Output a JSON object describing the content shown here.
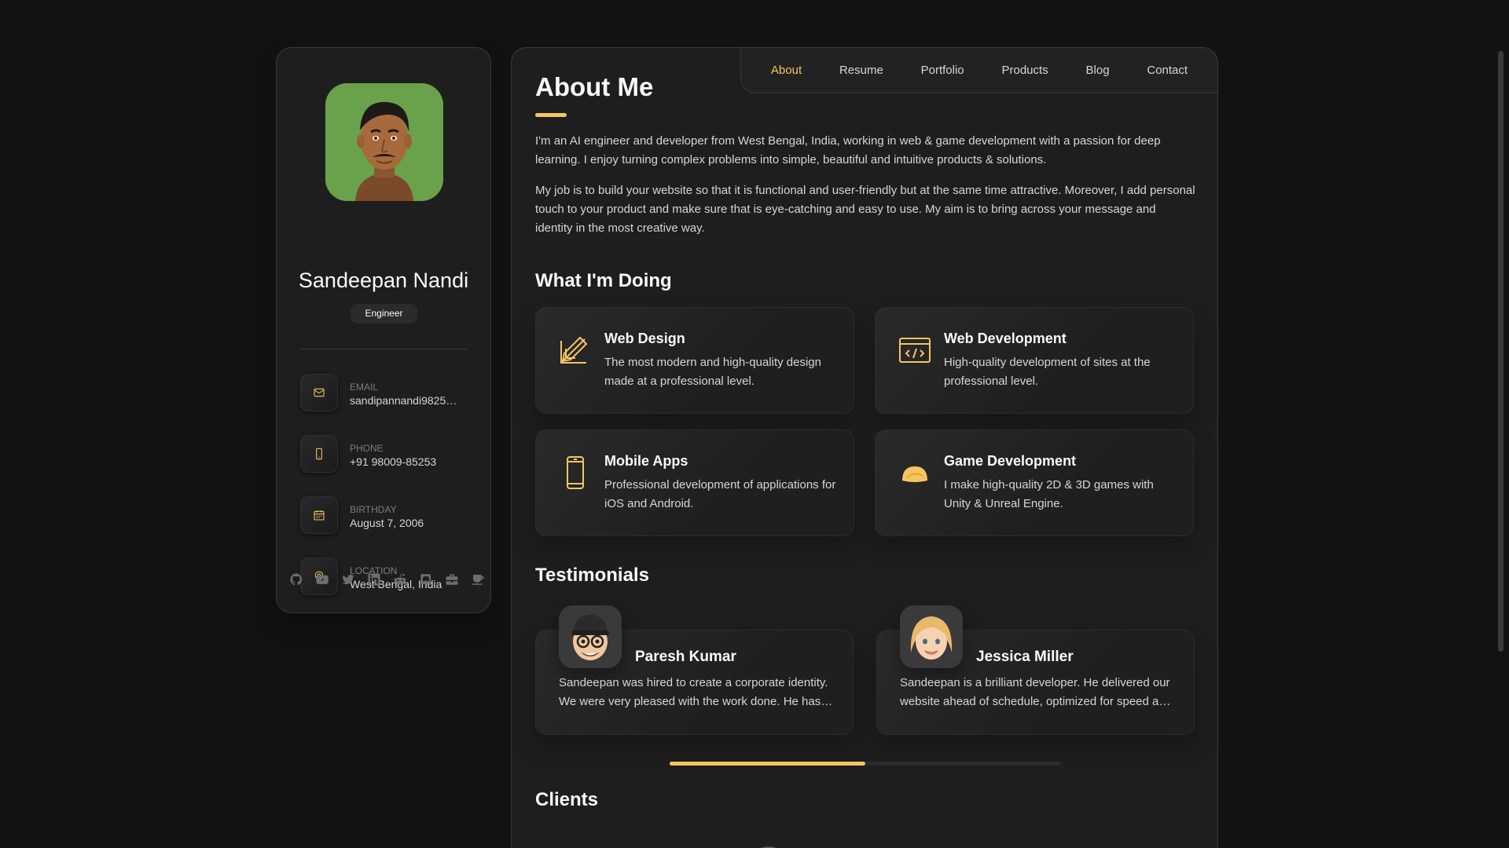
{
  "profile": {
    "name": "Sandeepan Nandi",
    "title": "Engineer",
    "avatar_bg": "#6aa24b"
  },
  "contacts": [
    {
      "icon": "mail-icon",
      "label": "Email",
      "value": "sandipannandi9825…"
    },
    {
      "icon": "phone-icon",
      "label": "Phone",
      "value": "+91 98009-85253"
    },
    {
      "icon": "calendar-icon",
      "label": "Birthday",
      "value": "August 7, 2006"
    },
    {
      "icon": "location-pin-icon",
      "label": "Location",
      "value": "West Bengal, India"
    }
  ],
  "socials": [
    "github-icon",
    "youtube-icon",
    "twitter-icon",
    "linkedin-icon",
    "reddit-icon",
    "discord-icon",
    "briefcase-icon",
    "coffee-icon"
  ],
  "nav": {
    "items": [
      "About",
      "Resume",
      "Portfolio",
      "Products",
      "Blog",
      "Contact"
    ],
    "active": "About"
  },
  "about": {
    "heading": "About Me",
    "paragraph1": "I'm an AI engineer and developer from West Bengal, India, working in web & game development with a passion for deep learning. I enjoy turning complex problems into simple, beautiful and intuitive products & solutions.",
    "paragraph2": "My job is to build your website so that it is functional and user-friendly but at the same time attractive. Moreover, I add personal touch to your product and make sure that is eye-catching and easy to use. My aim is to bring across your message and identity in the most creative way."
  },
  "services": {
    "heading": "What I'm Doing",
    "items": [
      {
        "icon": "design-pencil-ruler-icon",
        "title": "Web Design",
        "desc": "The most modern and high-quality design made at a professional level."
      },
      {
        "icon": "code-window-icon",
        "title": "Web Development",
        "desc": "High-quality development of sites at the professional level."
      },
      {
        "icon": "smartphone-icon",
        "title": "Mobile Apps",
        "desc": "Professional development of applications for iOS and Android."
      },
      {
        "icon": "game-blob-icon",
        "title": "Game Development",
        "desc": "I make high-quality 2D & 3D games with Unity & Unreal Engine."
      }
    ]
  },
  "testimonials": {
    "heading": "Testimonials",
    "items": [
      {
        "name": "Paresh Kumar",
        "text": "Sandeepan was hired to create a corporate identity. We were very pleased with the work done. He has a lot of experience and is very concerned about the needs of client."
      },
      {
        "name": "Jessica Miller",
        "text": "Sandeepan is a brilliant developer. He delivered our website ahead of schedule, optimized for speed and fully responsive across all devices."
      }
    ],
    "scroll_progress": 0.5
  },
  "clients": {
    "heading": "Clients"
  },
  "colors": {
    "accent": "#f5c561",
    "background": "#121212",
    "card": "#1e1e1f"
  }
}
